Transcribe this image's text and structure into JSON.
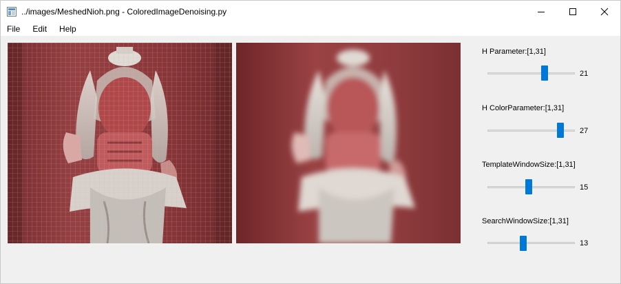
{
  "window": {
    "title": "../images/MeshedNioh.png - ColoredImageDenoising.py",
    "minimize_icon": "minimize-icon",
    "maximize_icon": "maximize-icon",
    "close_icon": "close-icon"
  },
  "menu": [
    {
      "label": "File"
    },
    {
      "label": "Edit"
    },
    {
      "label": "Help"
    }
  ],
  "images": {
    "original": {
      "description_icon": "meshed-nioh-original-image"
    },
    "denoised": {
      "description_icon": "meshed-nioh-denoised-image"
    }
  },
  "parameters": [
    {
      "label": "H Parameter:[1,31]",
      "value": "21",
      "min": 1,
      "max": 31,
      "numeric": 21
    },
    {
      "label": "H ColorParameter:[1,31]",
      "value": "27",
      "min": 1,
      "max": 31,
      "numeric": 27
    },
    {
      "label": "TemplateWindowSize:[1,31]",
      "value": "15",
      "min": 1,
      "max": 31,
      "numeric": 15
    },
    {
      "label": "SearchWindowSize:[1,31]",
      "value": "13",
      "min": 1,
      "max": 31,
      "numeric": 13
    }
  ],
  "colors": {
    "accent": "#0078d7",
    "background_red": "#8c3a3a",
    "statue_white": "#d8d2cc"
  }
}
